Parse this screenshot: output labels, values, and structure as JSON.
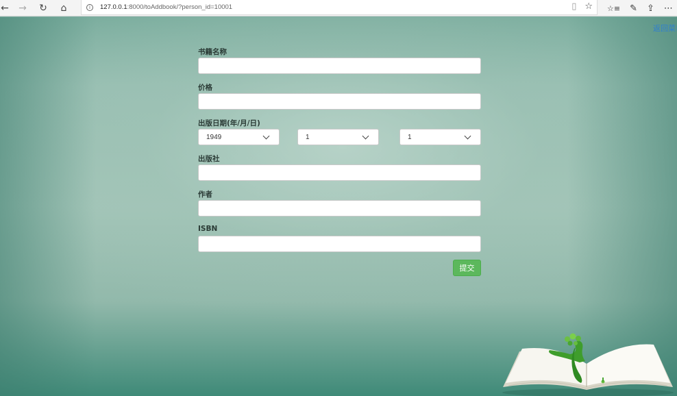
{
  "browser": {
    "url_host": "127.0.0.1",
    "url_rest": ":8000/toAddbook/?person_id=10001",
    "back_glyph": "←",
    "forward_glyph": "→",
    "refresh_glyph": "↻",
    "home_glyph": "⌂",
    "info_glyph": "i",
    "reading_glyph": "▯",
    "favorite_glyph": "☆",
    "hub_glyph": "☆≡",
    "notes_glyph": "✎",
    "share_glyph": "⇪",
    "more_glyph": "⋯"
  },
  "page": {
    "back_link": "返回菜单"
  },
  "form": {
    "title_label": "书籍名称",
    "title_value": "",
    "price_label": "价格",
    "price_value": "",
    "date_label": "出版日期(年/月/日)",
    "year_value": "1949",
    "month_value": "1",
    "day_value": "1",
    "publisher_label": "出版社",
    "publisher_value": "",
    "author_label": "作者",
    "author_value": "",
    "isbn_label": "ISBN",
    "isbn_value": "",
    "submit_label": "提交"
  },
  "colors": {
    "submit_bg": "#5cb85c",
    "link": "#2f7fd0"
  }
}
